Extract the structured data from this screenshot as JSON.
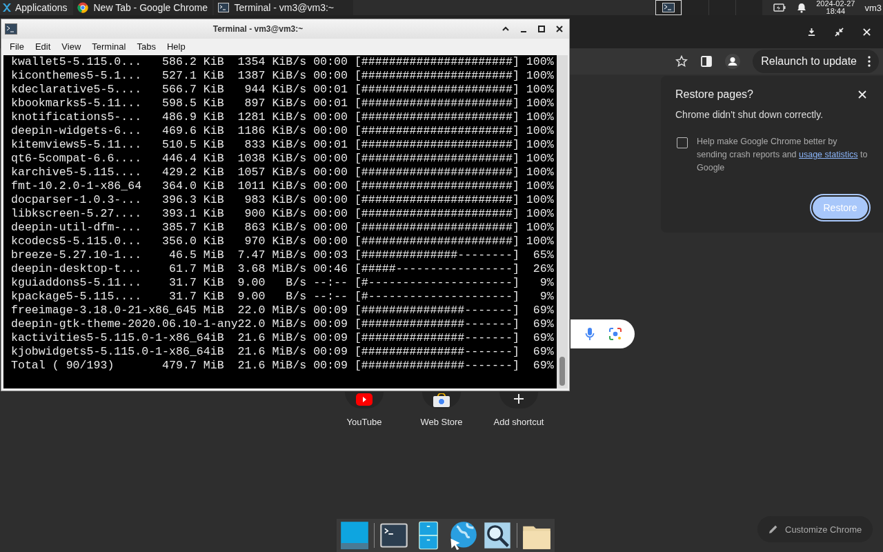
{
  "top_panel": {
    "applications_label": "Applications",
    "tasks": [
      {
        "label": "New Tab - Google Chrome",
        "kind": "chrome"
      },
      {
        "label": "Terminal - vm3@vm3:~",
        "kind": "terminal"
      }
    ],
    "clock": {
      "date": "2024-02-27",
      "time": "18:44"
    },
    "user": "vm3"
  },
  "browser": {
    "relaunch_label": "Relaunch to update",
    "restore_popup": {
      "title": "Restore pages?",
      "message": "Chrome didn't shut down correctly.",
      "option": {
        "text_before": "Help make Google Chrome better by sending crash reports and ",
        "link": "usage statistics",
        "text_after": " to Google",
        "checked": false
      },
      "button": "Restore"
    },
    "shortcuts": [
      {
        "label": "YouTube",
        "kind": "youtube"
      },
      {
        "label": "Web Store",
        "kind": "webstore"
      },
      {
        "label": "Add shortcut",
        "kind": "add"
      }
    ],
    "customize_label": "Customize Chrome"
  },
  "terminal": {
    "title": "Terminal - vm3@vm3:~",
    "menu": [
      "File",
      "Edit",
      "View",
      "Terminal",
      "Tabs",
      "Help"
    ],
    "lines": [
      "kwallet5-5.115.0...   586.2 KiB  1354 KiB/s 00:00 [######################] 100%",
      "kiconthemes5-5.1...   527.1 KiB  1387 KiB/s 00:00 [######################] 100%",
      "kdeclarative5-5....   566.7 KiB   944 KiB/s 00:01 [######################] 100%",
      "kbookmarks5-5.11...   598.5 KiB   897 KiB/s 00:01 [######################] 100%",
      "knotifications5-...   486.9 KiB  1281 KiB/s 00:00 [######################] 100%",
      "deepin-widgets-6...   469.6 KiB  1186 KiB/s 00:00 [######################] 100%",
      "kitemviews5-5.11...   510.5 KiB   833 KiB/s 00:01 [######################] 100%",
      "qt6-5compat-6.6....   446.4 KiB  1038 KiB/s 00:00 [######################] 100%",
      "karchive5-5.115....   429.2 KiB  1057 KiB/s 00:00 [######################] 100%",
      "fmt-10.2.0-1-x86_64   364.0 KiB  1011 KiB/s 00:00 [######################] 100%",
      "docparser-1.0.3-...   396.3 KiB   983 KiB/s 00:00 [######################] 100%",
      "libkscreen-5.27....   393.1 KiB   900 KiB/s 00:00 [######################] 100%",
      "deepin-util-dfm-...   385.7 KiB   863 KiB/s 00:00 [######################] 100%",
      "kcodecs5-5.115.0...   356.0 KiB   970 KiB/s 00:00 [######################] 100%",
      "breeze-5.27.10-1...    46.5 MiB  7.47 MiB/s 00:03 [##############--------]  65%",
      "deepin-desktop-t...    61.7 MiB  3.68 MiB/s 00:46 [#####-----------------]  26%",
      "kguiaddons5-5.11...    31.7 KiB  9.00   B/s --:-- [#---------------------]   9%",
      "kpackage5-5.115....    31.7 KiB  9.00   B/s --:-- [#---------------------]   9%",
      "freeimage-3.18.0-21-x86_645 MiB  22.0 MiB/s 00:09 [###############-------]  69%",
      "deepin-gtk-theme-2020.06.10-1-any22.0 MiB/s 00:09 [###############-------]  69%",
      "kactivities5-5.115.0-1-x86_64iB  21.6 MiB/s 00:09 [###############-------]  69%",
      "kjobwidgets5-5.115.0-1-x86_64iB  21.6 MiB/s 00:09 [###############-------]  69%",
      "Total ( 90/193)       479.7 MiB  21.6 MiB/s 00:09 [###############-------]  69%"
    ]
  },
  "dock": [
    {
      "kind": "desktop"
    },
    {
      "kind": "separator"
    },
    {
      "kind": "terminal"
    },
    {
      "kind": "files"
    },
    {
      "kind": "browser"
    },
    {
      "kind": "finder"
    },
    {
      "kind": "separator"
    },
    {
      "kind": "folder"
    }
  ]
}
